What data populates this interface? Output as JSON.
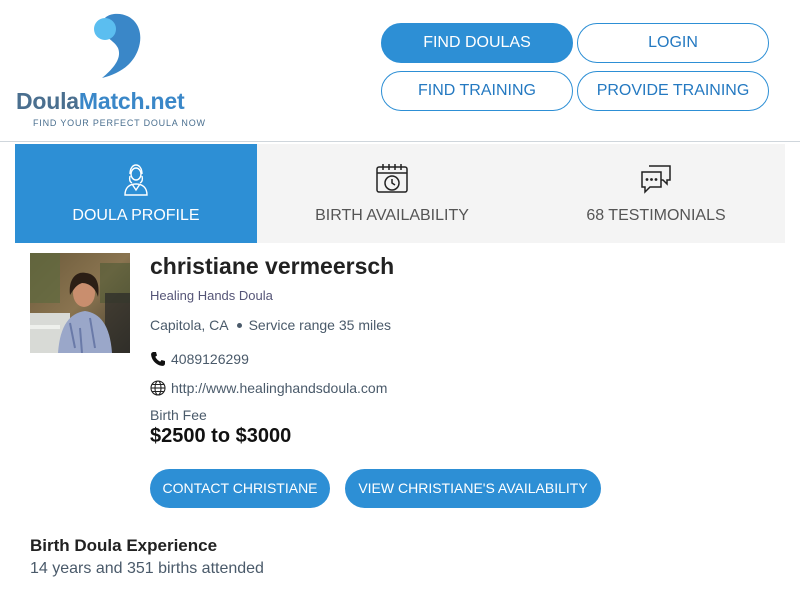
{
  "brand": {
    "name_part1": "Doula",
    "name_part2": "Match.net",
    "tagline": "FIND YOUR PERFECT DOULA NOW",
    "colors": {
      "primary": "#2d8fd5",
      "logo_light": "#5bbef0",
      "logo_dark": "#3a87c8",
      "tab_bg": "#f4f4f4"
    }
  },
  "nav": {
    "find_doulas": "FIND DOULAS",
    "login": "LOGIN",
    "find_training": "FIND TRAINING",
    "provide_training": "PROVIDE TRAINING"
  },
  "tabs": [
    {
      "label": "DOULA PROFILE",
      "icon": "person-icon",
      "active": true
    },
    {
      "label": "BIRTH AVAILABILITY",
      "icon": "calendar-clock-icon",
      "active": false
    },
    {
      "label": "68 TESTIMONIALS",
      "icon": "chat-bubbles-icon",
      "active": false
    }
  ],
  "profile": {
    "name": "christiane vermeersch",
    "business": "Healing Hands Doula",
    "location": "Capitola, CA",
    "service_range": "Service range 35 miles",
    "phone": "4089126299",
    "website": "http://www.healinghandsdoula.com",
    "fee_label": "Birth Fee",
    "fee_value": "$2500 to $3000",
    "contact_button": "CONTACT CHRISTIANE",
    "availability_button": "VIEW CHRISTIANE'S AVAILABILITY"
  },
  "experience": {
    "title": "Birth Doula Experience",
    "text": "14 years and 351 births attended"
  }
}
